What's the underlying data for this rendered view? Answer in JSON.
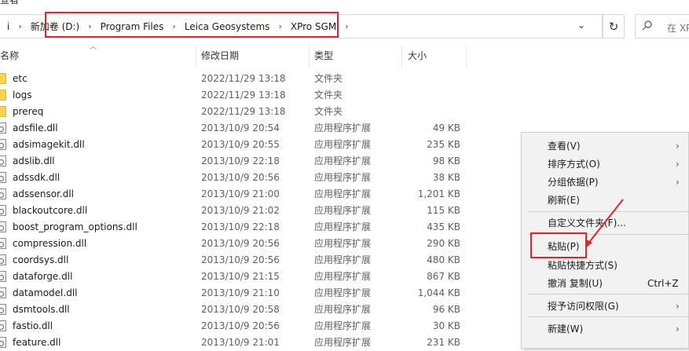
{
  "window": {
    "title_fragment": "查看"
  },
  "address_bar": {
    "left_fragment": "i",
    "crumbs": [
      "新加卷 (D:)",
      "Program Files",
      "Leica Geosystems",
      "XPro SGM"
    ],
    "separator_glyph": "›",
    "dropdown_glyph": "⌄"
  },
  "refresh": {
    "glyph": "↻"
  },
  "search": {
    "placeholder": "在 XPr",
    "icon": "search-icon"
  },
  "columns": {
    "name": "名称",
    "date": "修改日期",
    "type": "类型",
    "size": "大小"
  },
  "files": [
    {
      "name": "etc",
      "date": "2022/11/29 13:18",
      "type": "文件夹",
      "size": "",
      "icon": "folder-icon"
    },
    {
      "name": "logs",
      "date": "2022/11/29 13:18",
      "type": "文件夹",
      "size": "",
      "icon": "folder-icon"
    },
    {
      "name": "prereq",
      "date": "2022/11/29 13:18",
      "type": "文件夹",
      "size": "",
      "icon": "folder-icon"
    },
    {
      "name": "adsfile.dll",
      "date": "2013/10/9 20:54",
      "type": "应用程序扩展",
      "size": "49 KB",
      "icon": "dll-icon"
    },
    {
      "name": "adsimagekit.dll",
      "date": "2013/10/9 20:55",
      "type": "应用程序扩展",
      "size": "235 KB",
      "icon": "dll-icon"
    },
    {
      "name": "adslib.dll",
      "date": "2013/10/9 22:18",
      "type": "应用程序扩展",
      "size": "98 KB",
      "icon": "dll-icon"
    },
    {
      "name": "adssdk.dll",
      "date": "2013/10/9 20:56",
      "type": "应用程序扩展",
      "size": "38 KB",
      "icon": "dll-icon"
    },
    {
      "name": "adssensor.dll",
      "date": "2013/10/9 21:00",
      "type": "应用程序扩展",
      "size": "1,201 KB",
      "icon": "dll-icon"
    },
    {
      "name": "blackoutcore.dll",
      "date": "2013/10/9 21:02",
      "type": "应用程序扩展",
      "size": "115 KB",
      "icon": "dll-icon"
    },
    {
      "name": "boost_program_options.dll",
      "date": "2013/10/9 22:18",
      "type": "应用程序扩展",
      "size": "435 KB",
      "icon": "dll-icon"
    },
    {
      "name": "compression.dll",
      "date": "2013/10/9 20:56",
      "type": "应用程序扩展",
      "size": "290 KB",
      "icon": "dll-icon"
    },
    {
      "name": "coordsys.dll",
      "date": "2013/10/9 20:56",
      "type": "应用程序扩展",
      "size": "480 KB",
      "icon": "dll-icon"
    },
    {
      "name": "dataforge.dll",
      "date": "2013/10/9 21:15",
      "type": "应用程序扩展",
      "size": "867 KB",
      "icon": "dll-icon"
    },
    {
      "name": "datamodel.dll",
      "date": "2013/10/9 21:10",
      "type": "应用程序扩展",
      "size": "1,044 KB",
      "icon": "dll-icon"
    },
    {
      "name": "dsmtools.dll",
      "date": "2013/10/9 20:58",
      "type": "应用程序扩展",
      "size": "96 KB",
      "icon": "dll-icon"
    },
    {
      "name": "fastio.dll",
      "date": "2013/10/9 20:56",
      "type": "应用程序扩展",
      "size": "30 KB",
      "icon": "dll-icon"
    },
    {
      "name": "feature.dll",
      "date": "2013/10/9 21:01",
      "type": "应用程序扩展",
      "size": "231 KB",
      "icon": "dll-icon"
    }
  ],
  "context_menu": {
    "items": [
      {
        "label": "查看(V)",
        "shortcut": "",
        "submenu": true
      },
      {
        "label": "排序方式(O)",
        "shortcut": "",
        "submenu": true
      },
      {
        "label": "分组依据(P)",
        "shortcut": "",
        "submenu": true
      },
      {
        "label": "刷新(E)",
        "shortcut": "",
        "submenu": false
      },
      {
        "label": "自定义文件夹(F)...",
        "shortcut": "",
        "submenu": false
      },
      {
        "label": "粘贴(P)",
        "shortcut": "",
        "submenu": false
      },
      {
        "label": "粘贴快捷方式(S)",
        "shortcut": "",
        "submenu": false
      },
      {
        "label": "撤消 复制(U)",
        "shortcut": "Ctrl+Z",
        "submenu": false
      },
      {
        "label": "授予访问权限(G)",
        "shortcut": "",
        "submenu": true
      },
      {
        "label": "新建(W)",
        "shortcut": "",
        "submenu": true
      }
    ],
    "submenu_glyph": "›"
  },
  "colors": {
    "highlight_red": "#e0242c",
    "folder_yellow": "#ffd34a",
    "menu_bg": "#f2f2f2"
  }
}
